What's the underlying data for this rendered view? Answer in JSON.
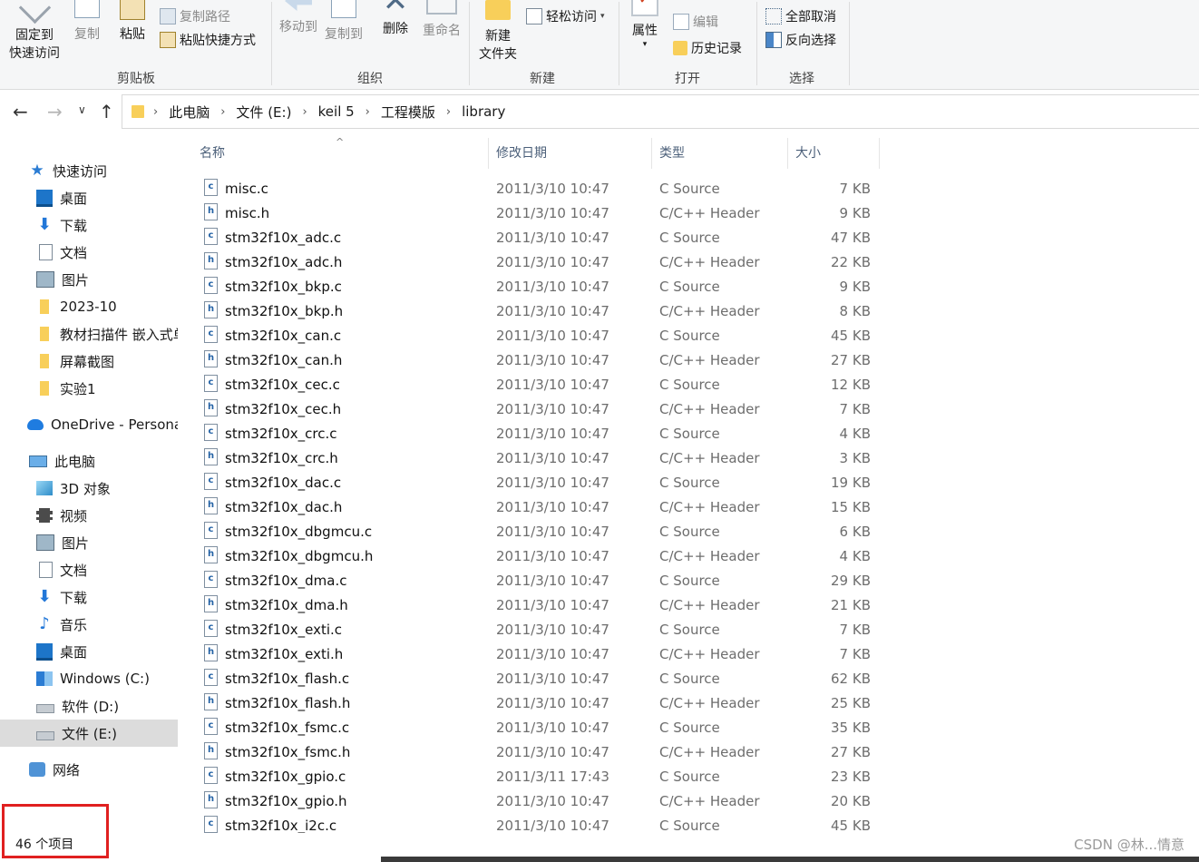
{
  "ribbon": {
    "clipboard": {
      "pin_label_1": "固定到",
      "pin_label_2": "快速访问",
      "copy_label": "复制",
      "paste_label": "粘贴",
      "copy_path_label": "复制路径",
      "paste_shortcut_label": "粘贴快捷方式",
      "group_label": "剪贴板"
    },
    "organize": {
      "move_to_label": "移动到",
      "copy_to_label": "复制到",
      "delete_label": "删除",
      "rename_label": "重命名",
      "group_label": "组织"
    },
    "new": {
      "new_folder_label_1": "新建",
      "new_folder_label_2": "文件夹",
      "easy_access_label": "轻松访问",
      "group_label": "新建"
    },
    "open": {
      "properties_label": "属性",
      "edit_label": "编辑",
      "history_label": "历史记录",
      "group_label": "打开"
    },
    "select": {
      "select_none_label": "全部取消",
      "invert_label": "反向选择",
      "group_label": "选择"
    }
  },
  "address": {
    "crumbs": [
      "此电脑",
      "文件 (E:)",
      "keil 5",
      "工程模版",
      "library"
    ]
  },
  "nav": {
    "quick_access": "快速访问",
    "items": [
      {
        "label": "桌面",
        "icon": "desktop-icon",
        "pinned": true
      },
      {
        "label": "下载",
        "icon": "download-icon",
        "pinned": true
      },
      {
        "label": "文档",
        "icon": "documents-icon",
        "pinned": true
      },
      {
        "label": "图片",
        "icon": "pictures-icon",
        "pinned": true
      },
      {
        "label": "2023-10",
        "icon": "folder-icon"
      },
      {
        "label": "教材扫描件 嵌入式单",
        "icon": "folder-icon"
      },
      {
        "label": "屏幕截图",
        "icon": "folder-icon"
      },
      {
        "label": "实验1",
        "icon": "folder-icon"
      }
    ],
    "onedrive": "OneDrive - Personal",
    "this_pc": "此电脑",
    "pc_items": [
      {
        "label": "3D 对象",
        "icon": "3d-objects-icon"
      },
      {
        "label": "视频",
        "icon": "video-icon"
      },
      {
        "label": "图片",
        "icon": "pictures-icon"
      },
      {
        "label": "文档",
        "icon": "documents-icon"
      },
      {
        "label": "下载",
        "icon": "download-icon"
      },
      {
        "label": "音乐",
        "icon": "music-icon"
      },
      {
        "label": "桌面",
        "icon": "desktop-icon"
      },
      {
        "label": "Windows (C:)",
        "icon": "windows-drive-icon"
      },
      {
        "label": "软件 (D:)",
        "icon": "drive-icon"
      },
      {
        "label": "文件 (E:)",
        "icon": "drive-icon",
        "selected": true
      }
    ],
    "network": "网络"
  },
  "list": {
    "headers": {
      "name": "名称",
      "date": "修改日期",
      "type": "类型",
      "size": "大小"
    },
    "files": [
      {
        "name": "misc.c",
        "date": "2011/3/10 10:47",
        "type": "C Source",
        "size": "7 KB",
        "kind": "c"
      },
      {
        "name": "misc.h",
        "date": "2011/3/10 10:47",
        "type": "C/C++ Header",
        "size": "9 KB",
        "kind": "h"
      },
      {
        "name": "stm32f10x_adc.c",
        "date": "2011/3/10 10:47",
        "type": "C Source",
        "size": "47 KB",
        "kind": "c"
      },
      {
        "name": "stm32f10x_adc.h",
        "date": "2011/3/10 10:47",
        "type": "C/C++ Header",
        "size": "22 KB",
        "kind": "h"
      },
      {
        "name": "stm32f10x_bkp.c",
        "date": "2011/3/10 10:47",
        "type": "C Source",
        "size": "9 KB",
        "kind": "c"
      },
      {
        "name": "stm32f10x_bkp.h",
        "date": "2011/3/10 10:47",
        "type": "C/C++ Header",
        "size": "8 KB",
        "kind": "h"
      },
      {
        "name": "stm32f10x_can.c",
        "date": "2011/3/10 10:47",
        "type": "C Source",
        "size": "45 KB",
        "kind": "c"
      },
      {
        "name": "stm32f10x_can.h",
        "date": "2011/3/10 10:47",
        "type": "C/C++ Header",
        "size": "27 KB",
        "kind": "h"
      },
      {
        "name": "stm32f10x_cec.c",
        "date": "2011/3/10 10:47",
        "type": "C Source",
        "size": "12 KB",
        "kind": "c"
      },
      {
        "name": "stm32f10x_cec.h",
        "date": "2011/3/10 10:47",
        "type": "C/C++ Header",
        "size": "7 KB",
        "kind": "h"
      },
      {
        "name": "stm32f10x_crc.c",
        "date": "2011/3/10 10:47",
        "type": "C Source",
        "size": "4 KB",
        "kind": "c"
      },
      {
        "name": "stm32f10x_crc.h",
        "date": "2011/3/10 10:47",
        "type": "C/C++ Header",
        "size": "3 KB",
        "kind": "h"
      },
      {
        "name": "stm32f10x_dac.c",
        "date": "2011/3/10 10:47",
        "type": "C Source",
        "size": "19 KB",
        "kind": "c"
      },
      {
        "name": "stm32f10x_dac.h",
        "date": "2011/3/10 10:47",
        "type": "C/C++ Header",
        "size": "15 KB",
        "kind": "h"
      },
      {
        "name": "stm32f10x_dbgmcu.c",
        "date": "2011/3/10 10:47",
        "type": "C Source",
        "size": "6 KB",
        "kind": "c"
      },
      {
        "name": "stm32f10x_dbgmcu.h",
        "date": "2011/3/10 10:47",
        "type": "C/C++ Header",
        "size": "4 KB",
        "kind": "h"
      },
      {
        "name": "stm32f10x_dma.c",
        "date": "2011/3/10 10:47",
        "type": "C Source",
        "size": "29 KB",
        "kind": "c"
      },
      {
        "name": "stm32f10x_dma.h",
        "date": "2011/3/10 10:47",
        "type": "C/C++ Header",
        "size": "21 KB",
        "kind": "h"
      },
      {
        "name": "stm32f10x_exti.c",
        "date": "2011/3/10 10:47",
        "type": "C Source",
        "size": "7 KB",
        "kind": "c"
      },
      {
        "name": "stm32f10x_exti.h",
        "date": "2011/3/10 10:47",
        "type": "C/C++ Header",
        "size": "7 KB",
        "kind": "h"
      },
      {
        "name": "stm32f10x_flash.c",
        "date": "2011/3/10 10:47",
        "type": "C Source",
        "size": "62 KB",
        "kind": "c"
      },
      {
        "name": "stm32f10x_flash.h",
        "date": "2011/3/10 10:47",
        "type": "C/C++ Header",
        "size": "25 KB",
        "kind": "h"
      },
      {
        "name": "stm32f10x_fsmc.c",
        "date": "2011/3/10 10:47",
        "type": "C Source",
        "size": "35 KB",
        "kind": "c"
      },
      {
        "name": "stm32f10x_fsmc.h",
        "date": "2011/3/10 10:47",
        "type": "C/C++ Header",
        "size": "27 KB",
        "kind": "h"
      },
      {
        "name": "stm32f10x_gpio.c",
        "date": "2011/3/11 17:43",
        "type": "C Source",
        "size": "23 KB",
        "kind": "c"
      },
      {
        "name": "stm32f10x_gpio.h",
        "date": "2011/3/10 10:47",
        "type": "C/C++ Header",
        "size": "20 KB",
        "kind": "h"
      },
      {
        "name": "stm32f10x_i2c.c",
        "date": "2011/3/10 10:47",
        "type": "C Source",
        "size": "45 KB",
        "kind": "c"
      }
    ]
  },
  "status": {
    "item_count": "46 个项目"
  },
  "watermark": "CSDN @林...情意",
  "colors": {
    "accent": "#2b7cd3",
    "highlight_box": "#e02020",
    "selected_nav": "#dcdcdc"
  }
}
